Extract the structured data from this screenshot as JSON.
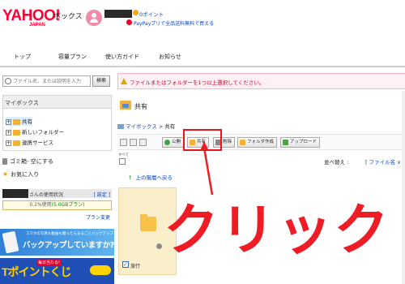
{
  "header": {
    "logo_text": "YAHOO!",
    "logo_sub": "JAPAN",
    "service_name": "ボックス",
    "points": "0ポイント",
    "paypay_text": "PayPayプリで全品送料無料で買える"
  },
  "nav": {
    "items": [
      "トップ",
      "容量プラン",
      "使い方ガイド",
      "お知らせ"
    ]
  },
  "sidebar": {
    "search_placeholder": "ファイル名、または説明を入力",
    "search_button": "検索",
    "mybox_title": "マイボックス",
    "tree": [
      "共有",
      "新しいフォルダー",
      "連携サービス"
    ],
    "trash_label": "ゴミ箱",
    "trash_empty": "- 空にする",
    "favorites_label": "お気に入り",
    "usage_label": "さんの使用状況",
    "usage_settings": "[ 設定 ]",
    "usage_percent": "0.1%使用",
    "usage_capacity": "(5.0GBプラン)",
    "plan_change": "プラン変更",
    "ad_backup_small": "スマホの写真も動画も撮ったらまるごとバックアップ",
    "ad_backup_main": "バックアップしていますか?",
    "ad_tpoint_tag": "毎日当たる!",
    "ad_tpoint_main": "Tポイントくじ"
  },
  "main": {
    "alert": "ファイルまたはフォルダーを1つ以上選択してください。",
    "folder_title": "共有",
    "breadcrumb_root": "マイボックス",
    "breadcrumb_sep": ">",
    "breadcrumb_current": "共有",
    "toolbar": {
      "public": "公開",
      "share": "共有",
      "delete": "削除",
      "new_folder": "フォルダ作成",
      "upload": "アップロード"
    },
    "select_all": "すべて",
    "sort_label": "並べ替え :",
    "sort_value": "[ ファイル名 ∨ ]",
    "up_link": "上の階層へ戻る",
    "items": [
      {
        "name": "旅行"
      }
    ]
  },
  "annotation": {
    "click_text": "クリック"
  },
  "colors": {
    "brand_red": "#ff0033",
    "annotation_red": "#ee1c25",
    "link_blue": "#0044cc",
    "folder_yellow": "#f8c24a"
  }
}
